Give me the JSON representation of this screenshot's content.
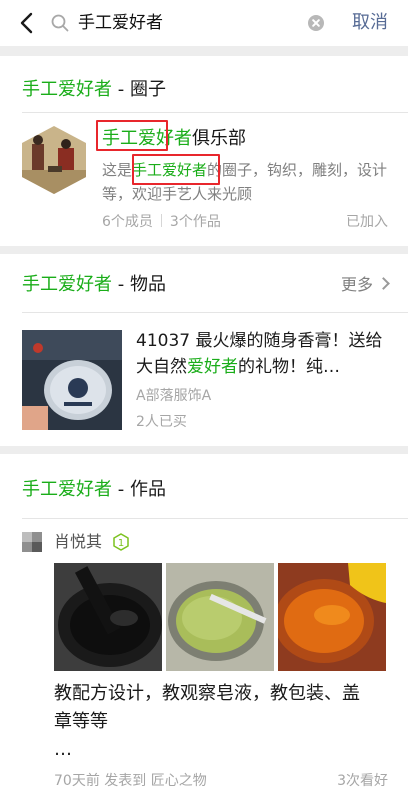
{
  "search": {
    "query": "手工爱好者",
    "cancel_label": "取消"
  },
  "circle_section": {
    "keyword": "手工爱好者",
    "suffix": " - 圈子",
    "circle": {
      "name_keyword": "手工爱好者",
      "name_rest": "俱乐部",
      "desc_prefix": "这是",
      "desc_keyword": "手工爱好者",
      "desc_rest": "的圈子，钩织，雕刻，设计等，欢迎手艺人来光顾",
      "members": "6个成员",
      "works": "3个作品",
      "status": "已加入"
    }
  },
  "goods_section": {
    "keyword": "手工爱好者",
    "suffix": " - 物品",
    "more_label": "更多",
    "item": {
      "title_prefix": "41037 最火爆的随身香膏！送给大自然",
      "title_keyword": "爱好者",
      "title_rest": "的礼物！纯…",
      "shop": "A部落服饰A",
      "buyers": "2人已买"
    }
  },
  "works_section": {
    "keyword": "手工爱好者",
    "suffix": " - 作品",
    "post": {
      "author": "肖悦其",
      "level": "1",
      "title_line1": "教配方设计，教观察皂液，教包装、盖",
      "title_line2": "章等等",
      "title_line3": "…",
      "meta": "70天前 发表到 匠心之物",
      "likes": "3次看好"
    }
  },
  "colors": {
    "highlight": "#1aad19",
    "link": "#576b95",
    "annotation_box": "#e8262c"
  }
}
